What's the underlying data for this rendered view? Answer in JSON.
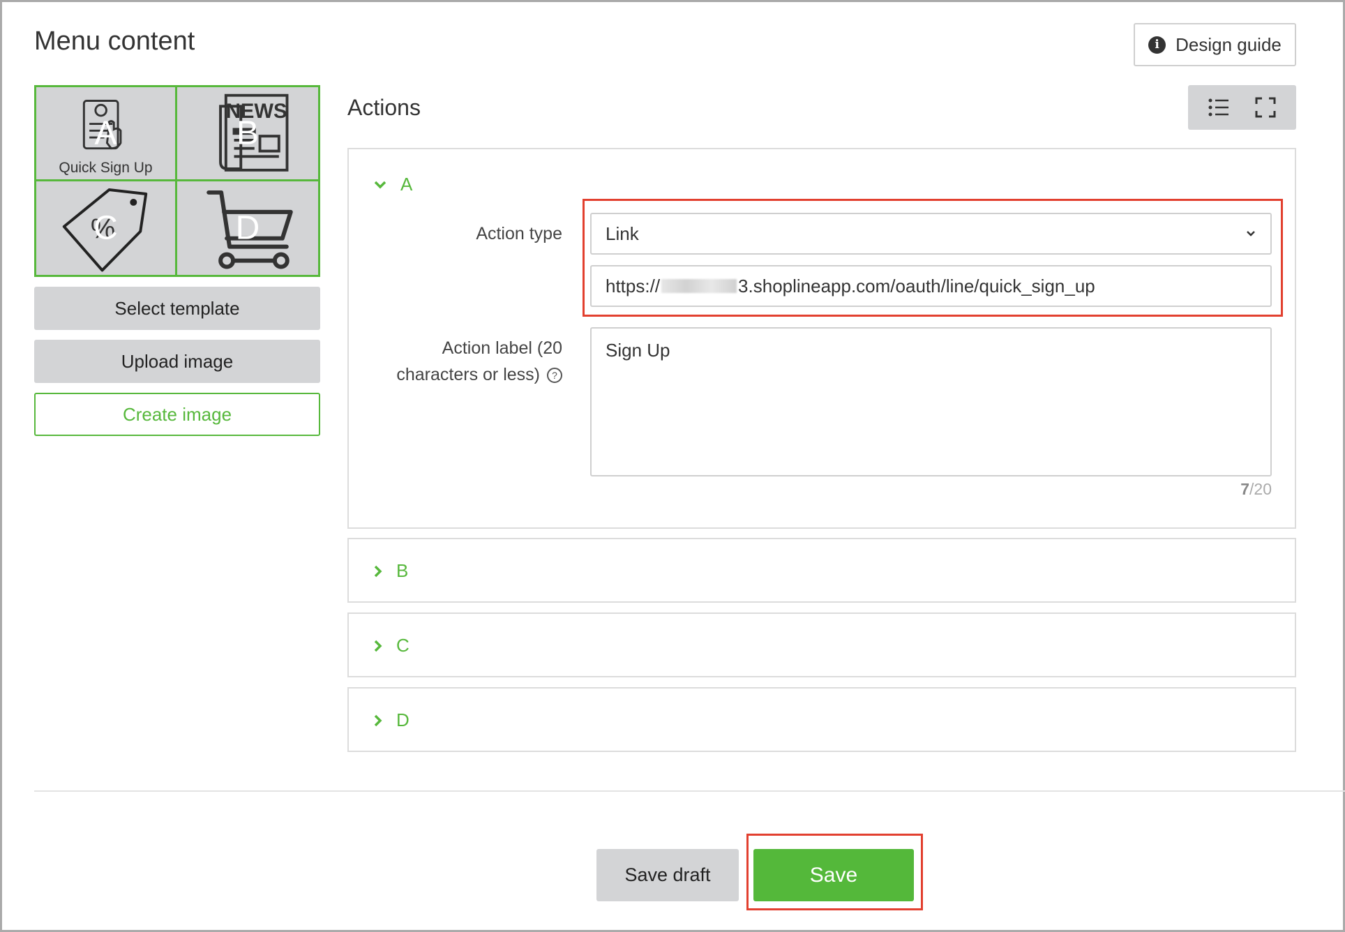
{
  "header": {
    "title": "Menu content",
    "design_guide_label": "Design guide"
  },
  "menu_preview": {
    "cells": [
      {
        "letter": "A",
        "caption": "Quick Sign Up",
        "icon": "signup-form-icon"
      },
      {
        "letter": "B",
        "caption": "",
        "icon": "newspaper-icon"
      },
      {
        "letter": "C",
        "caption": "",
        "icon": "price-tag-icon"
      },
      {
        "letter": "D",
        "caption": "",
        "icon": "shopping-cart-icon"
      }
    ]
  },
  "left_buttons": {
    "select_template": "Select template",
    "upload_image": "Upload image",
    "create_image": "Create image"
  },
  "actions": {
    "title": "Actions",
    "panels": [
      {
        "id": "A",
        "expanded": true
      },
      {
        "id": "B",
        "expanded": false
      },
      {
        "id": "C",
        "expanded": false
      },
      {
        "id": "D",
        "expanded": false
      }
    ],
    "form": {
      "action_type_label": "Action type",
      "action_type_value": "Link",
      "url_prefix": "https://",
      "url_suffix": "3.shoplineapp.com/oauth/line/quick_sign_up",
      "action_label_label_line1": "Action label (20",
      "action_label_label_line2": "characters or less)",
      "action_label_value": "Sign Up",
      "counter_current": "7",
      "counter_max": "/20"
    }
  },
  "footer": {
    "save_draft": "Save draft",
    "save": "Save"
  },
  "colors": {
    "accent_green": "#57b83c",
    "highlight_red": "#e2402f",
    "button_gray": "#d3d4d6"
  }
}
